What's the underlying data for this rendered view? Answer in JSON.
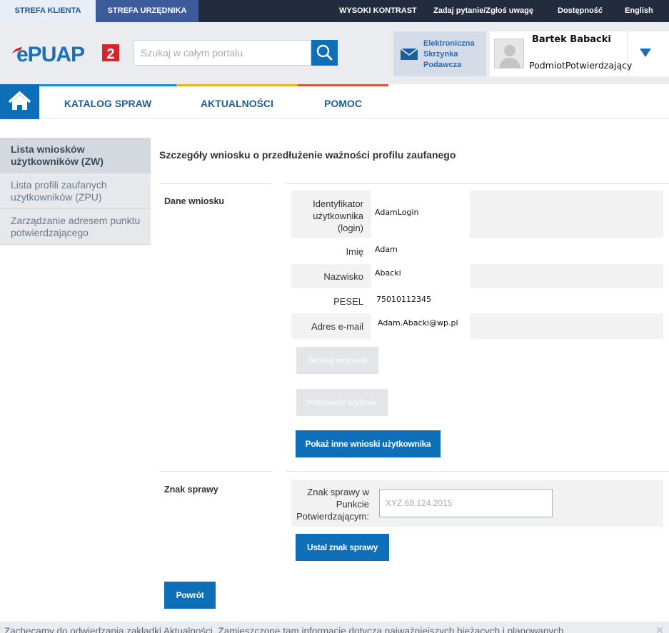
{
  "topbar": {
    "zone_client": "STREFA KLIENTA",
    "zone_official": "STREFA URZĘDNIKA",
    "high_contrast": "WYSOKI KONTRAST",
    "ask_question": "Zadaj pytanie/Zgłoś uwagę",
    "accessibility": "Dostępność",
    "language": "English"
  },
  "header": {
    "search_placeholder": "Szukaj w całym portalu",
    "mailbox_label": "Elektroniczna Skrzynka Podawcza",
    "user_name": "Bartek Babacki",
    "user_role": "PodmiotPotwierdzający"
  },
  "nav": {
    "katalog": "KATALOG SPRAW",
    "aktualnosci": "AKTUALNOŚCI",
    "pomoc": "POMOC"
  },
  "sidebar": {
    "items": [
      {
        "label": "Lista wniosków użytkowników (ZW)"
      },
      {
        "label": "Lista profili zaufanych użytkowników (ZPU)"
      },
      {
        "label": "Zarządzanie adresem punktu potwierdzającego"
      }
    ]
  },
  "main": {
    "title": "Szczegóły wniosku o przedłużenie ważności profilu zaufanego",
    "section_request": "Dane wniosku",
    "fields": [
      {
        "label": "Identyfikator użytkownika (login)",
        "value": "AdamLogin"
      },
      {
        "label": "Imię",
        "value": "Adam"
      },
      {
        "label": "Nazwisko",
        "value": "Abacki"
      },
      {
        "label": "PESEL",
        "value": "75010112345"
      },
      {
        "label": "Adres e-mail",
        "value": "Adam.Abacki@wp.pl"
      }
    ],
    "btn_print": "Drukuj wniosek",
    "btn_confirm_print": "Potwierdź wydruk",
    "btn_show_other": "Pokaż inne wnioski użytkownika",
    "section_case": "Znak sprawy",
    "case_label": "Znak sprawy w Punkcie Potwierdzającym:",
    "case_placeholder": "XYZ.68.124.2015",
    "btn_set_case": "Ustal znak sprawy",
    "btn_back": "Powrót"
  },
  "notice": {
    "text": "Zachęcamy do odwiedzania zakładki Aktualności. Zamieszczone tam informacje dotyczą najważniejszych bieżących i planowanych"
  },
  "colors": {
    "primary": "#0e6eb8",
    "topbar": "#232b3e",
    "zone_official": "#3d5a9a",
    "logo_red": "#d7262b"
  },
  "icons": [
    "logo-epuap",
    "search-icon",
    "mail-icon",
    "avatar-icon",
    "chevron-down-icon",
    "home-icon",
    "close-icon"
  ]
}
